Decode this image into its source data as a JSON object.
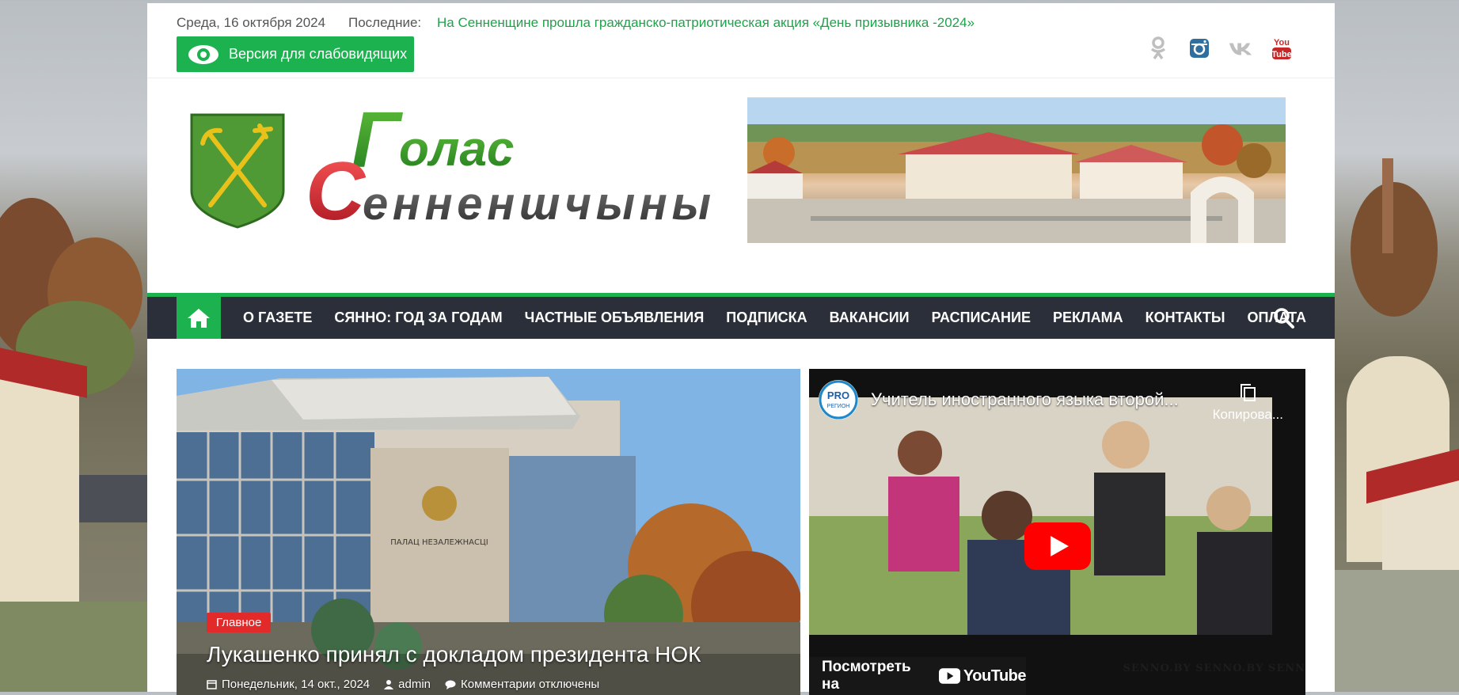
{
  "topbar": {
    "date": "Среда, 16 октября 2024",
    "latest_label": "Последние:",
    "latest_link": "На Сенненщине прошла гражданско-патриотическая акция «День призывника -2024»",
    "accessibility_button": "Версия для слабовидящих",
    "socials": [
      "odnoklassniki-icon",
      "instagram-icon",
      "vk-icon",
      "youtube-icon"
    ]
  },
  "header": {
    "logo_line1": "Голас",
    "logo_line2": "Сенненшчыны"
  },
  "nav": {
    "items": [
      "О ГАЗЕТЕ",
      "СЯННО: ГОД ЗА ГОДАМ",
      "ЧАСТНЫЕ ОБЪЯВЛЕНИЯ",
      "ПОДПИСКА",
      "ВАКАНСИИ",
      "РАСПИСАНИЕ",
      "РЕКЛАМА",
      "КОНТАКТЫ",
      "ОПЛАТА"
    ]
  },
  "feature": {
    "tag": "Главное",
    "title": "Лукашенко принял с докладом президента НОК",
    "date": "Понедельник, 14 окт., 2024",
    "author": "admin",
    "comments": "Комментарии отключены",
    "building_sign": "ПАЛАЦ НЕЗАЛЕЖНАСЦІ"
  },
  "video": {
    "channel": "PRO РЕГИОН",
    "title": "Учитель иностранного языка второй...",
    "copy_label": "Копирова...",
    "watch_on": "Посмотреть на",
    "youtube": "YouTube",
    "watermark": "SENNO.BY     SENNO.BY     SENN"
  },
  "colors": {
    "accent_green": "#1cb24f",
    "nav_bg": "#2b2f3a",
    "tag_red": "#e32a2a"
  }
}
